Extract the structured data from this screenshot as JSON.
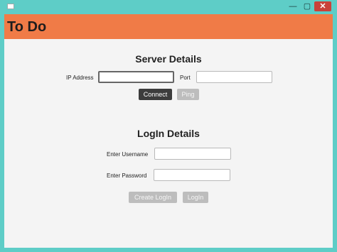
{
  "window": {
    "min_glyph": "—",
    "max_glyph": "▢",
    "close_glyph": "✕"
  },
  "header": {
    "title": "To Do"
  },
  "server": {
    "title": "Server Details",
    "ip_label": "IP Address",
    "ip_value": "",
    "port_label": "Port",
    "port_value": "",
    "connect_label": "Connect",
    "ping_label": "Ping"
  },
  "login": {
    "title": "LogIn Details",
    "username_label": "Enter Username",
    "username_value": "",
    "password_label": "Enter Password",
    "password_value": "",
    "create_label": "Create LogIn",
    "login_label": "LogIn"
  },
  "colors": {
    "accent": "#f07b47",
    "frame": "#5ecdc7",
    "dark_button": "#3c3c3c",
    "disabled_button": "#bdbdbd"
  }
}
